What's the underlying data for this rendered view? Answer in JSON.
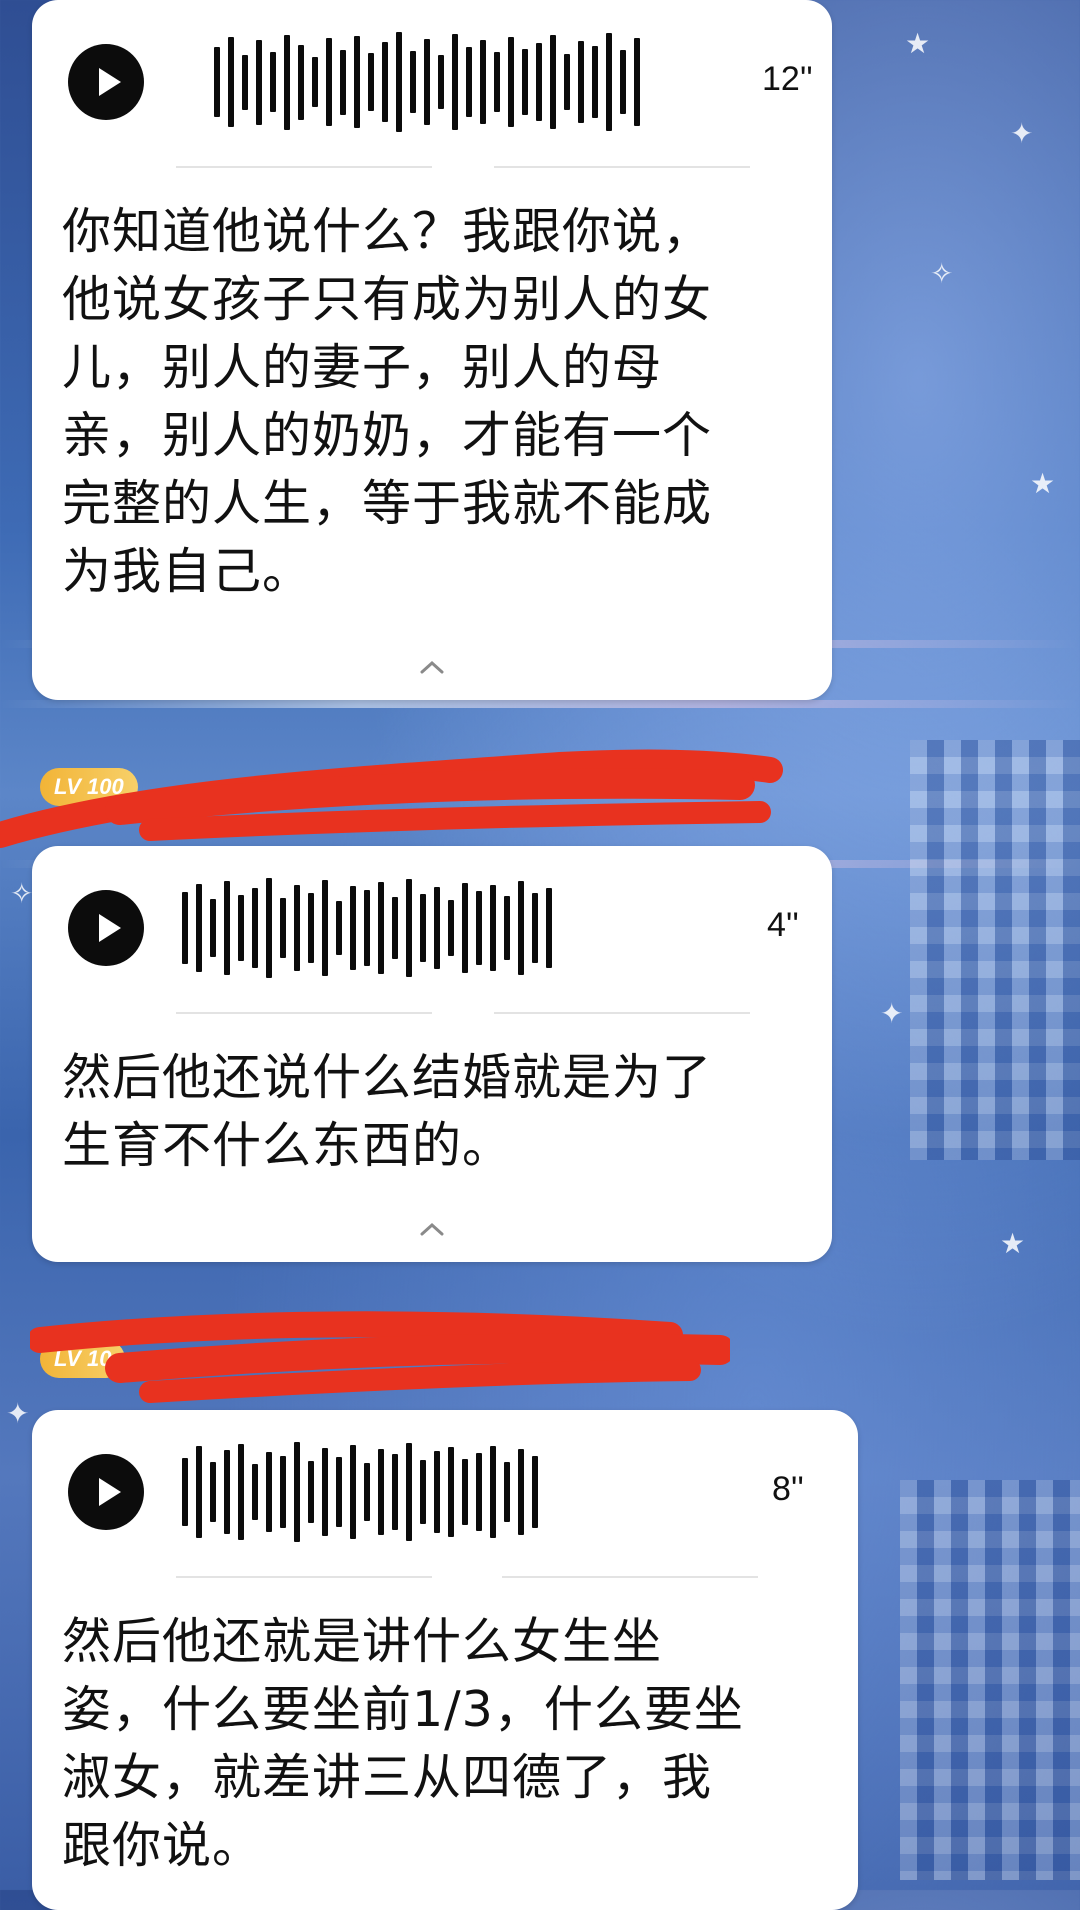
{
  "messages": [
    {
      "duration": "12''",
      "text": "你知道他说什么？我跟你说，\n他说女孩子只有成为别人的女\n儿，别人的妻子，别人的母\n亲，别人的奶奶，才能有一个\n完整的人生，等于我就不能成\n为我自己。",
      "waveform": [
        70,
        90,
        55,
        85,
        60,
        95,
        75,
        50,
        88,
        65,
        92,
        58,
        80,
        100,
        62,
        86,
        54,
        96,
        70,
        84,
        60,
        90,
        66,
        78,
        94,
        56,
        82,
        72,
        98,
        64,
        88
      ]
    },
    {
      "duration": "4''",
      "text": "然后他还说什么结婚就是为了\n生育不什么东西的。",
      "waveform": [
        72,
        88,
        58,
        94,
        66,
        80,
        100,
        60,
        86,
        70,
        96,
        54,
        84,
        76,
        92,
        62,
        98,
        68,
        82,
        56,
        90,
        74,
        86,
        64,
        94,
        70,
        80
      ]
    },
    {
      "duration": "8''",
      "text": "然后他还就是讲什么女生坐\n姿，什么要坐前1/3，什么要坐\n淑女，就差讲三从四德了，我\n跟你说。",
      "waveform": [
        68,
        92,
        60,
        84,
        96,
        56,
        80,
        72,
        100,
        62,
        88,
        70,
        94,
        58,
        86,
        76,
        98,
        64,
        82,
        90,
        66,
        78,
        92,
        60,
        86,
        72
      ]
    }
  ],
  "user_badges": [
    {
      "level": "LV 100"
    },
    {
      "level": "LV 10"
    }
  ],
  "icons": {
    "play": "play-icon",
    "collapse": "chevron-up-icon"
  },
  "colors": {
    "bubble": "#ffffff",
    "redaction": "#e8321f",
    "badge": "#f2b437"
  }
}
